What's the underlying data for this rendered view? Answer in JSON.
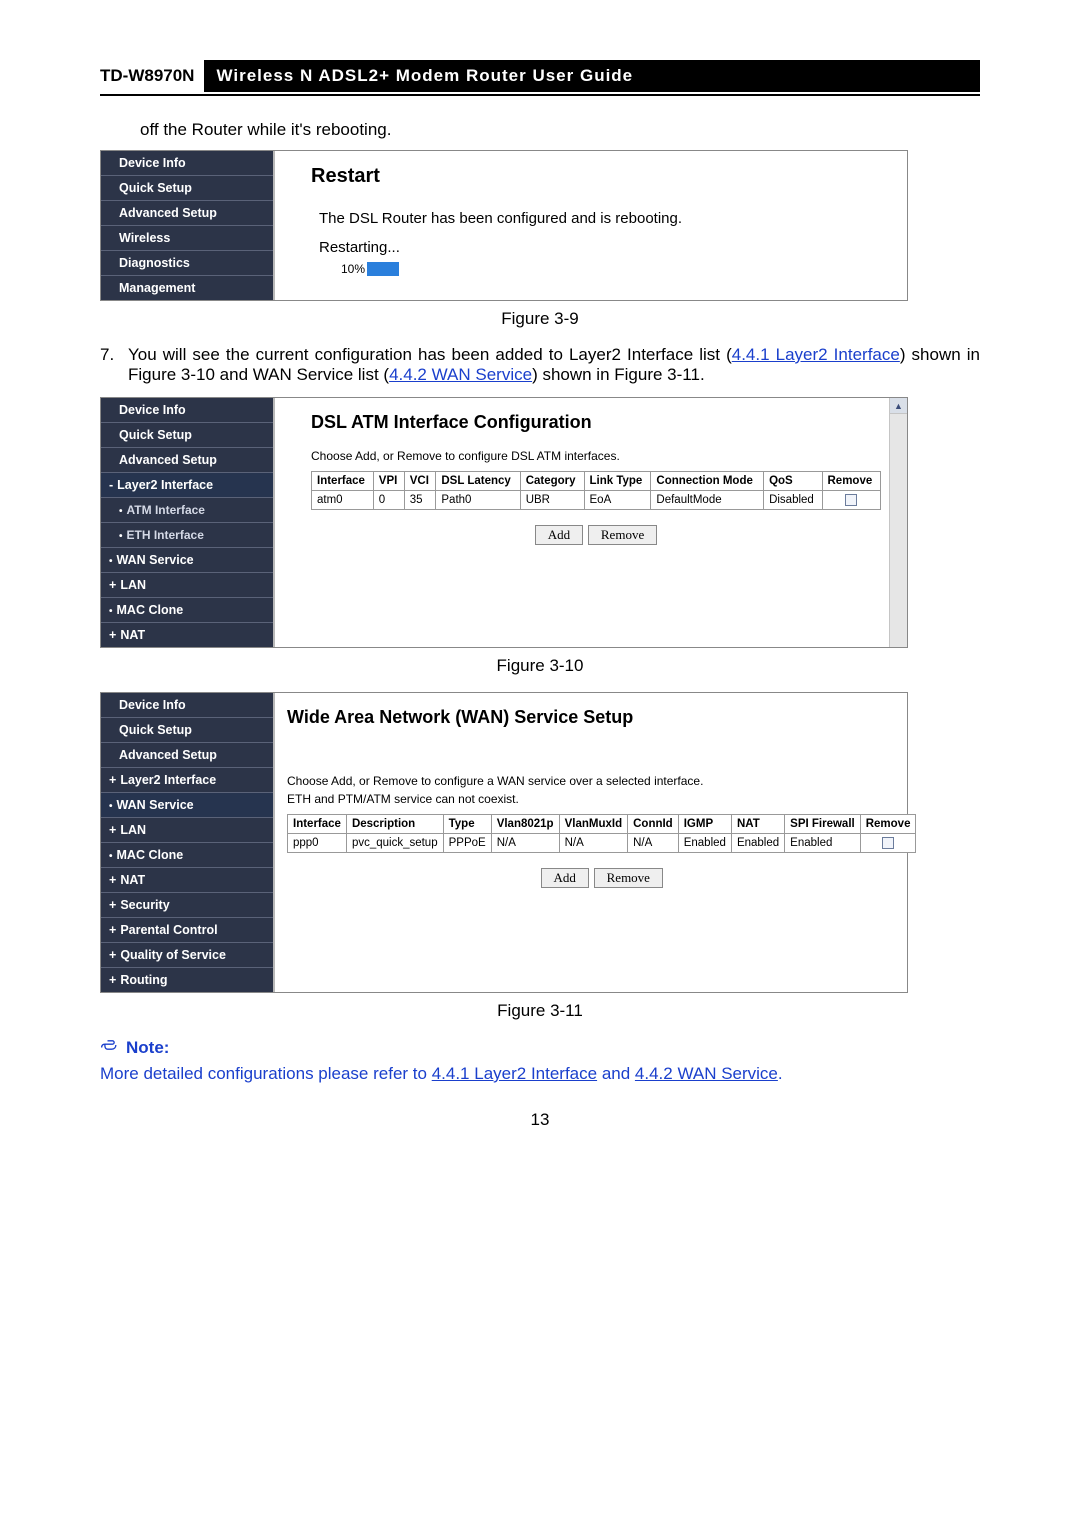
{
  "doc": {
    "model": "TD-W8970N",
    "title": "Wireless N ADSL2+ Modem Router User Guide"
  },
  "para_top": "off the Router while it's rebooting.",
  "fig_caption_1": "Figure 3-9",
  "fig_caption_2": "Figure 3-10",
  "fig_caption_3": "Figure 3-11",
  "numbered": {
    "num": "7.",
    "pre": "You will see the current configuration has been added to Layer2 Interface list (",
    "link1": "4.4.1 Layer2 Interface",
    "mid1": ") shown in Figure 3-10 and WAN Service list (",
    "link2": "4.4.2 WAN Service",
    "mid2": ") shown in Figure 3-11."
  },
  "sidebar1": {
    "items": [
      "Device Info",
      "Quick Setup",
      "Advanced Setup",
      "Wireless",
      "Diagnostics",
      "Management"
    ]
  },
  "pane1": {
    "h2": "Restart",
    "line": "The DSL Router has been configured and is rebooting.",
    "restarting": "Restarting...",
    "pct": "10%",
    "fill_pct": 10
  },
  "sidebar2": {
    "items": [
      {
        "label": "Device Info",
        "type": "top"
      },
      {
        "label": "Quick Setup",
        "type": "top"
      },
      {
        "label": "Advanced Setup",
        "type": "top"
      },
      {
        "label": "Layer2 Interface",
        "type": "expanded current"
      },
      {
        "label": "ATM Interface",
        "type": "leaf sub"
      },
      {
        "label": "ETH Interface",
        "type": "leaf sub"
      },
      {
        "label": "WAN Service",
        "type": "leaf"
      },
      {
        "label": "LAN",
        "type": "collapsed"
      },
      {
        "label": "MAC Clone",
        "type": "leaf"
      },
      {
        "label": "NAT",
        "type": "collapsed"
      }
    ]
  },
  "pane2": {
    "h2": "DSL ATM Interface Configuration",
    "desc": "Choose Add, or Remove to configure DSL ATM interfaces.",
    "headers": [
      "Interface",
      "VPI",
      "VCI",
      "DSL Latency",
      "Category",
      "Link Type",
      "Connection Mode",
      "QoS",
      "Remove"
    ],
    "row": [
      "atm0",
      "0",
      "35",
      "Path0",
      "UBR",
      "EoA",
      "DefaultMode",
      "Disabled"
    ],
    "add": "Add",
    "remove": "Remove"
  },
  "sidebar3": {
    "items": [
      {
        "label": "Device Info",
        "type": "top"
      },
      {
        "label": "Quick Setup",
        "type": "top"
      },
      {
        "label": "Advanced Setup",
        "type": "top"
      },
      {
        "label": "Layer2 Interface",
        "type": "collapsed"
      },
      {
        "label": "WAN Service",
        "type": "leaf current"
      },
      {
        "label": "LAN",
        "type": "collapsed"
      },
      {
        "label": "MAC Clone",
        "type": "leaf"
      },
      {
        "label": "NAT",
        "type": "collapsed"
      },
      {
        "label": "Security",
        "type": "collapsed"
      },
      {
        "label": "Parental Control",
        "type": "collapsed"
      },
      {
        "label": "Quality of Service",
        "type": "collapsed"
      },
      {
        "label": "Routing",
        "type": "collapsed"
      }
    ]
  },
  "pane3": {
    "h2": "Wide Area Network (WAN) Service Setup",
    "desc1": "Choose Add, or Remove to configure a WAN service over a selected interface.",
    "desc2": "ETH and PTM/ATM service can not coexist.",
    "headers": [
      "Interface",
      "Description",
      "Type",
      "Vlan8021p",
      "VlanMuxId",
      "ConnId",
      "IGMP",
      "NAT",
      "SPI Firewall",
      "Remove"
    ],
    "row": [
      "ppp0",
      "pvc_quick_setup",
      "PPPoE",
      "N/A",
      "N/A",
      "N/A",
      "Enabled",
      "Enabled",
      "Enabled"
    ],
    "add": "Add",
    "remove": "Remove"
  },
  "note": {
    "head": "Note:",
    "pre": "More detailed configurations please refer to ",
    "link1": "4.4.1 Layer2 Interface",
    "mid": " and ",
    "link2": "4.4.2 WAN Service",
    "post": "."
  },
  "page_num": "13"
}
